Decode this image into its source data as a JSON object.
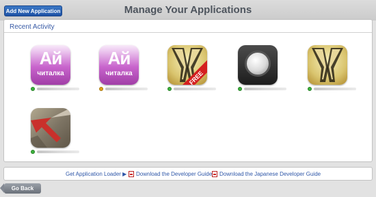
{
  "header": {
    "add_button_label": "Add New Application",
    "title": "Manage Your Applications"
  },
  "recent": {
    "title": "Recent Activity",
    "apps": [
      {
        "icon": "reader-app-icon",
        "icon_text_big": "Ай",
        "icon_text_small": "читалка",
        "status_color": "#3cb13c"
      },
      {
        "icon": "reader-app-icon",
        "icon_text_big": "Ай",
        "icon_text_small": "читалка",
        "status_color": "#e0a21a"
      },
      {
        "icon": "gold-app-icon",
        "badge": "FREE",
        "status_color": "#3cb13c"
      },
      {
        "icon": "lens-app-icon",
        "status_color": "#3cb13c"
      },
      {
        "icon": "gold-app-icon",
        "status_color": "#3cb13c"
      },
      {
        "icon": "wood-app-icon",
        "status_color": "#3cb13c"
      }
    ]
  },
  "footer": {
    "loader_link": "Get Application Loader ▶",
    "dev_guide_link": "Download the Developer Guide",
    "jp_guide_link": "Download the Japanese Developer Guide"
  },
  "go_back_label": "Go Back",
  "colors": {
    "accent_blue": "#2f57a8",
    "status_green": "#3cb13c",
    "status_orange": "#e0a21a"
  }
}
